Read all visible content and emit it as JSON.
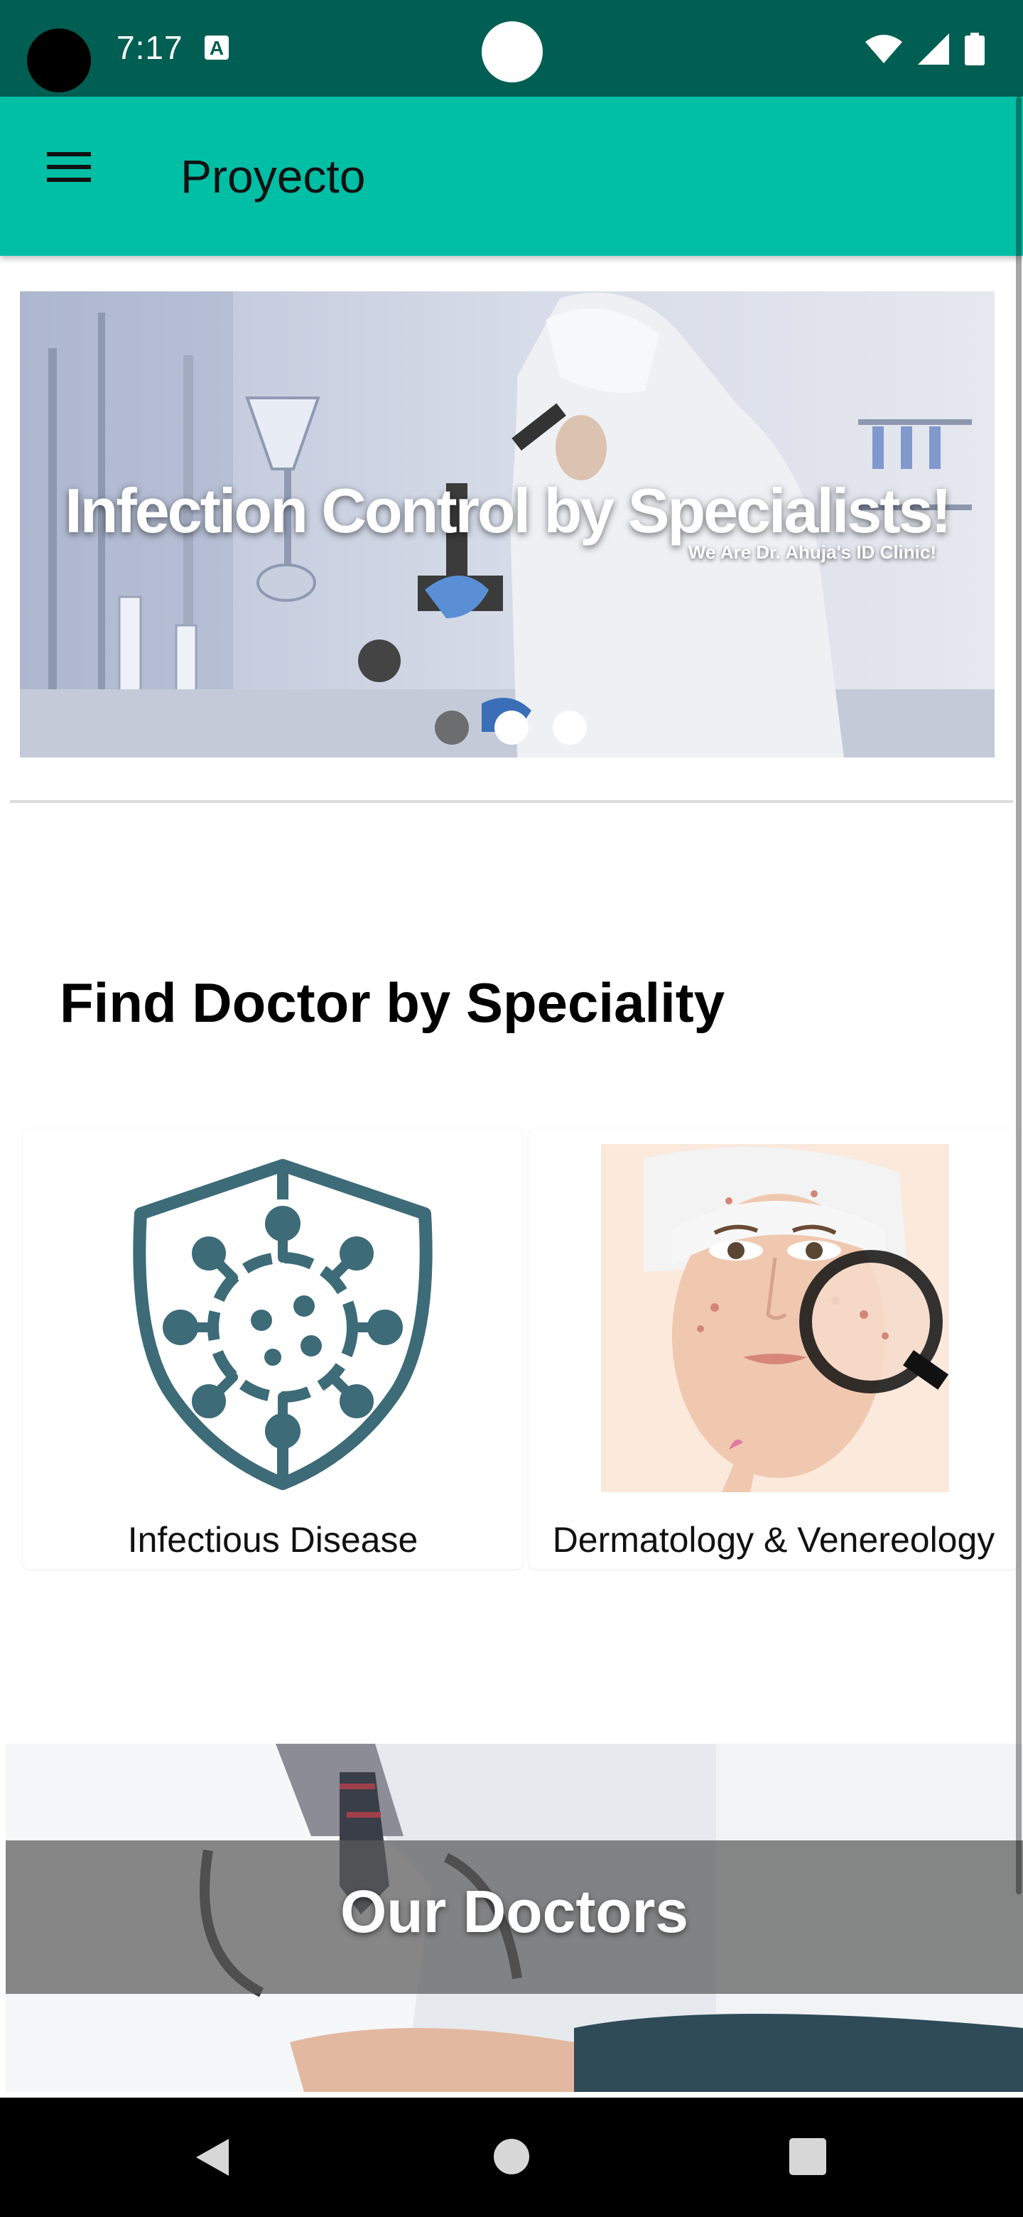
{
  "status_bar": {
    "time": "7:17",
    "a_icon": "A"
  },
  "app_bar": {
    "title": "Proyecto"
  },
  "banner": {
    "title": "Infection Control by Specialists!",
    "subtitle": "We Are Dr. Ahuja's ID Clinic!",
    "active_slide": 1,
    "slide_count": 3
  },
  "section": {
    "title": "Find Doctor by Speciality"
  },
  "specialities": [
    {
      "label": "Infectious Disease",
      "icon": "virus-shield-icon"
    },
    {
      "label": "Dermatology & Venereology",
      "icon": "skin-magnifier-image"
    }
  ],
  "doctors": {
    "title": "Our Doctors"
  },
  "colors": {
    "status_bar": "#005f52",
    "app_bar": "#00bfa5",
    "icon_teal": "#3d6b78"
  }
}
